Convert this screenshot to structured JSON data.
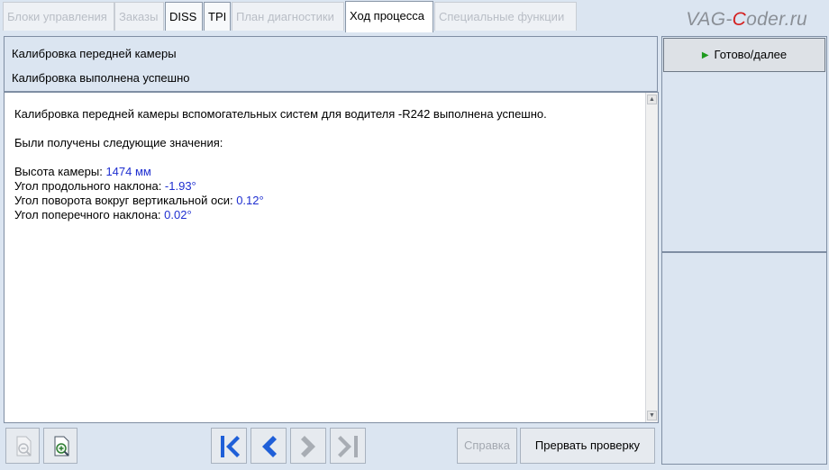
{
  "tabs": [
    {
      "label": "Блоки управления",
      "state": "disabled"
    },
    {
      "label": "Заказы",
      "state": "disabled"
    },
    {
      "label": "DISS",
      "state": "enabled"
    },
    {
      "label": "TPI",
      "state": "enabled"
    },
    {
      "label": "План диагностики",
      "state": "disabled"
    },
    {
      "label": "Ход процесса",
      "state": "active"
    },
    {
      "label": "Специальные функции",
      "state": "disabled"
    }
  ],
  "watermark": {
    "prefix": "VAG-",
    "c": "C",
    "suffix": "oder.ru"
  },
  "header": {
    "title": "Калибровка передней камеры",
    "status": "Калибровка выполнена успешно"
  },
  "content": {
    "line1": "Калибровка передней камеры вспомогательных систем для водителя -R242 выполнена успешно.",
    "line2": "Были получены следующие значения:",
    "values": [
      {
        "label": "Высота камеры: ",
        "value": "1474 мм"
      },
      {
        "label": "Угол продольного наклона: ",
        "value": "-1.93°"
      },
      {
        "label": "Угол поворота вокруг вертикальной оси: ",
        "value": "0.12°"
      },
      {
        "label": "Угол поперечного наклона: ",
        "value": "0.02°"
      }
    ]
  },
  "right_panel": {
    "next_button": "Готово/далее"
  },
  "toolbar": {
    "help_label": "Справка",
    "abort_label": "Прервать проверку"
  },
  "colors": {
    "value_text": "#1f2fd0",
    "accent_blue": "#1f5fd8",
    "play_green": "#1e9a1e",
    "background": "#dbe5f1"
  }
}
